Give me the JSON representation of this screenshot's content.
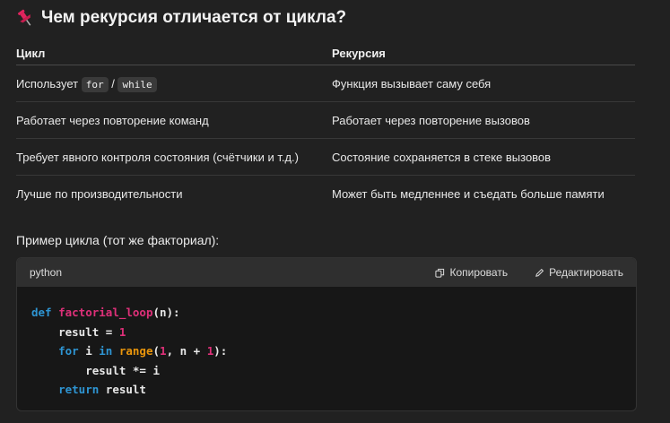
{
  "heading": {
    "title": "Чем рекурсия отличается от цикла?",
    "icon": "pushpin-icon"
  },
  "table": {
    "headers": [
      "Цикл",
      "Рекурсия"
    ],
    "row0": {
      "prefix": "Использует",
      "code1": "for",
      "sep": "/",
      "code2": "while",
      "right": "Функция вызывает саму себя"
    },
    "row1": {
      "left": "Работает через повторение команд",
      "right": "Работает через повторение вызовов"
    },
    "row2": {
      "left": "Требует явного контроля состояния (счётчики и т.д.)",
      "right": "Состояние сохраняется в стеке вызовов"
    },
    "row3": {
      "left": "Лучше по производительности",
      "right": "Может быть медленнее и съедать больше памяти"
    }
  },
  "example": {
    "label": "Пример цикла (тот же факториал):"
  },
  "codeblock": {
    "language": "python",
    "copy_label": "Копировать",
    "edit_label": "Редактировать",
    "line1": {
      "kw": "def",
      "fn": "factorial_loop",
      "rest": "(n):"
    },
    "line2": {
      "indent": "    ",
      "text": "result = ",
      "num": "1"
    },
    "line3": {
      "indent": "    ",
      "kw_for": "for",
      "var": " i ",
      "kw_in": "in",
      "sp": " ",
      "bi": "range",
      "p1": "(",
      "num1": "1",
      "p2": ", n + ",
      "num2": "1",
      "p3": "):"
    },
    "line4": {
      "indent": "        ",
      "text": "result *= i"
    },
    "line5": {
      "indent": "    ",
      "kw": "return",
      "text": " result"
    }
  },
  "colors": {
    "background": "#212121",
    "keyword": "#2e95d3",
    "function": "#df3079",
    "builtin": "#e9950c"
  }
}
